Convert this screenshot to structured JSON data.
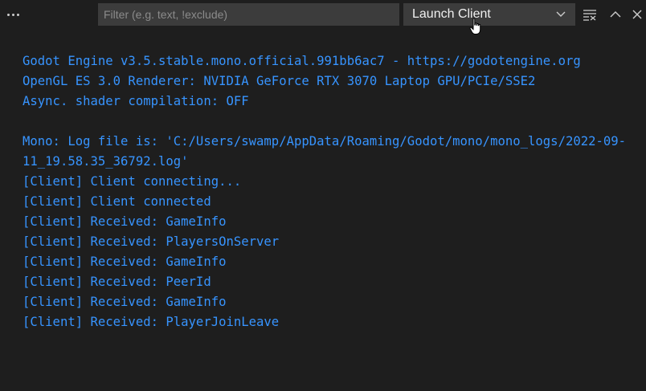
{
  "toolbar": {
    "more_icon": "ellipsis-icon",
    "filter": {
      "placeholder": "Filter (e.g. text, !exclude)",
      "value": ""
    },
    "channel_select": {
      "selected": "Launch Client",
      "icon": "chevron-down-icon"
    },
    "actions": [
      {
        "name": "clear-output",
        "icon": "clear-all-icon"
      },
      {
        "name": "maximize-panel",
        "icon": "chevron-up-icon"
      },
      {
        "name": "close-panel",
        "icon": "close-icon"
      }
    ]
  },
  "output": {
    "lines": [
      "Godot Engine v3.5.stable.mono.official.991bb6ac7 - https://godotengine.org",
      "OpenGL ES 3.0 Renderer: NVIDIA GeForce RTX 3070 Laptop GPU/PCIe/SSE2",
      "Async. shader compilation: OFF",
      "",
      "Mono: Log file is: 'C:/Users/swamp/AppData/Roaming/Godot/mono/mono_logs/2022-09-",
      "11_19.58.35_36792.log'",
      "[Client] Client connecting...",
      "[Client] Client connected",
      "[Client] Received: GameInfo",
      "[Client] Received: PlayersOnServer",
      "[Client] Received: GameInfo",
      "[Client] Received: PeerId",
      "[Client] Received: GameInfo",
      "[Client] Received: PlayerJoinLeave"
    ]
  },
  "colors": {
    "background": "#1e1e1e",
    "input_background": "#3c3c3c",
    "output_text": "#3794ff",
    "icon": "#cccccc"
  }
}
